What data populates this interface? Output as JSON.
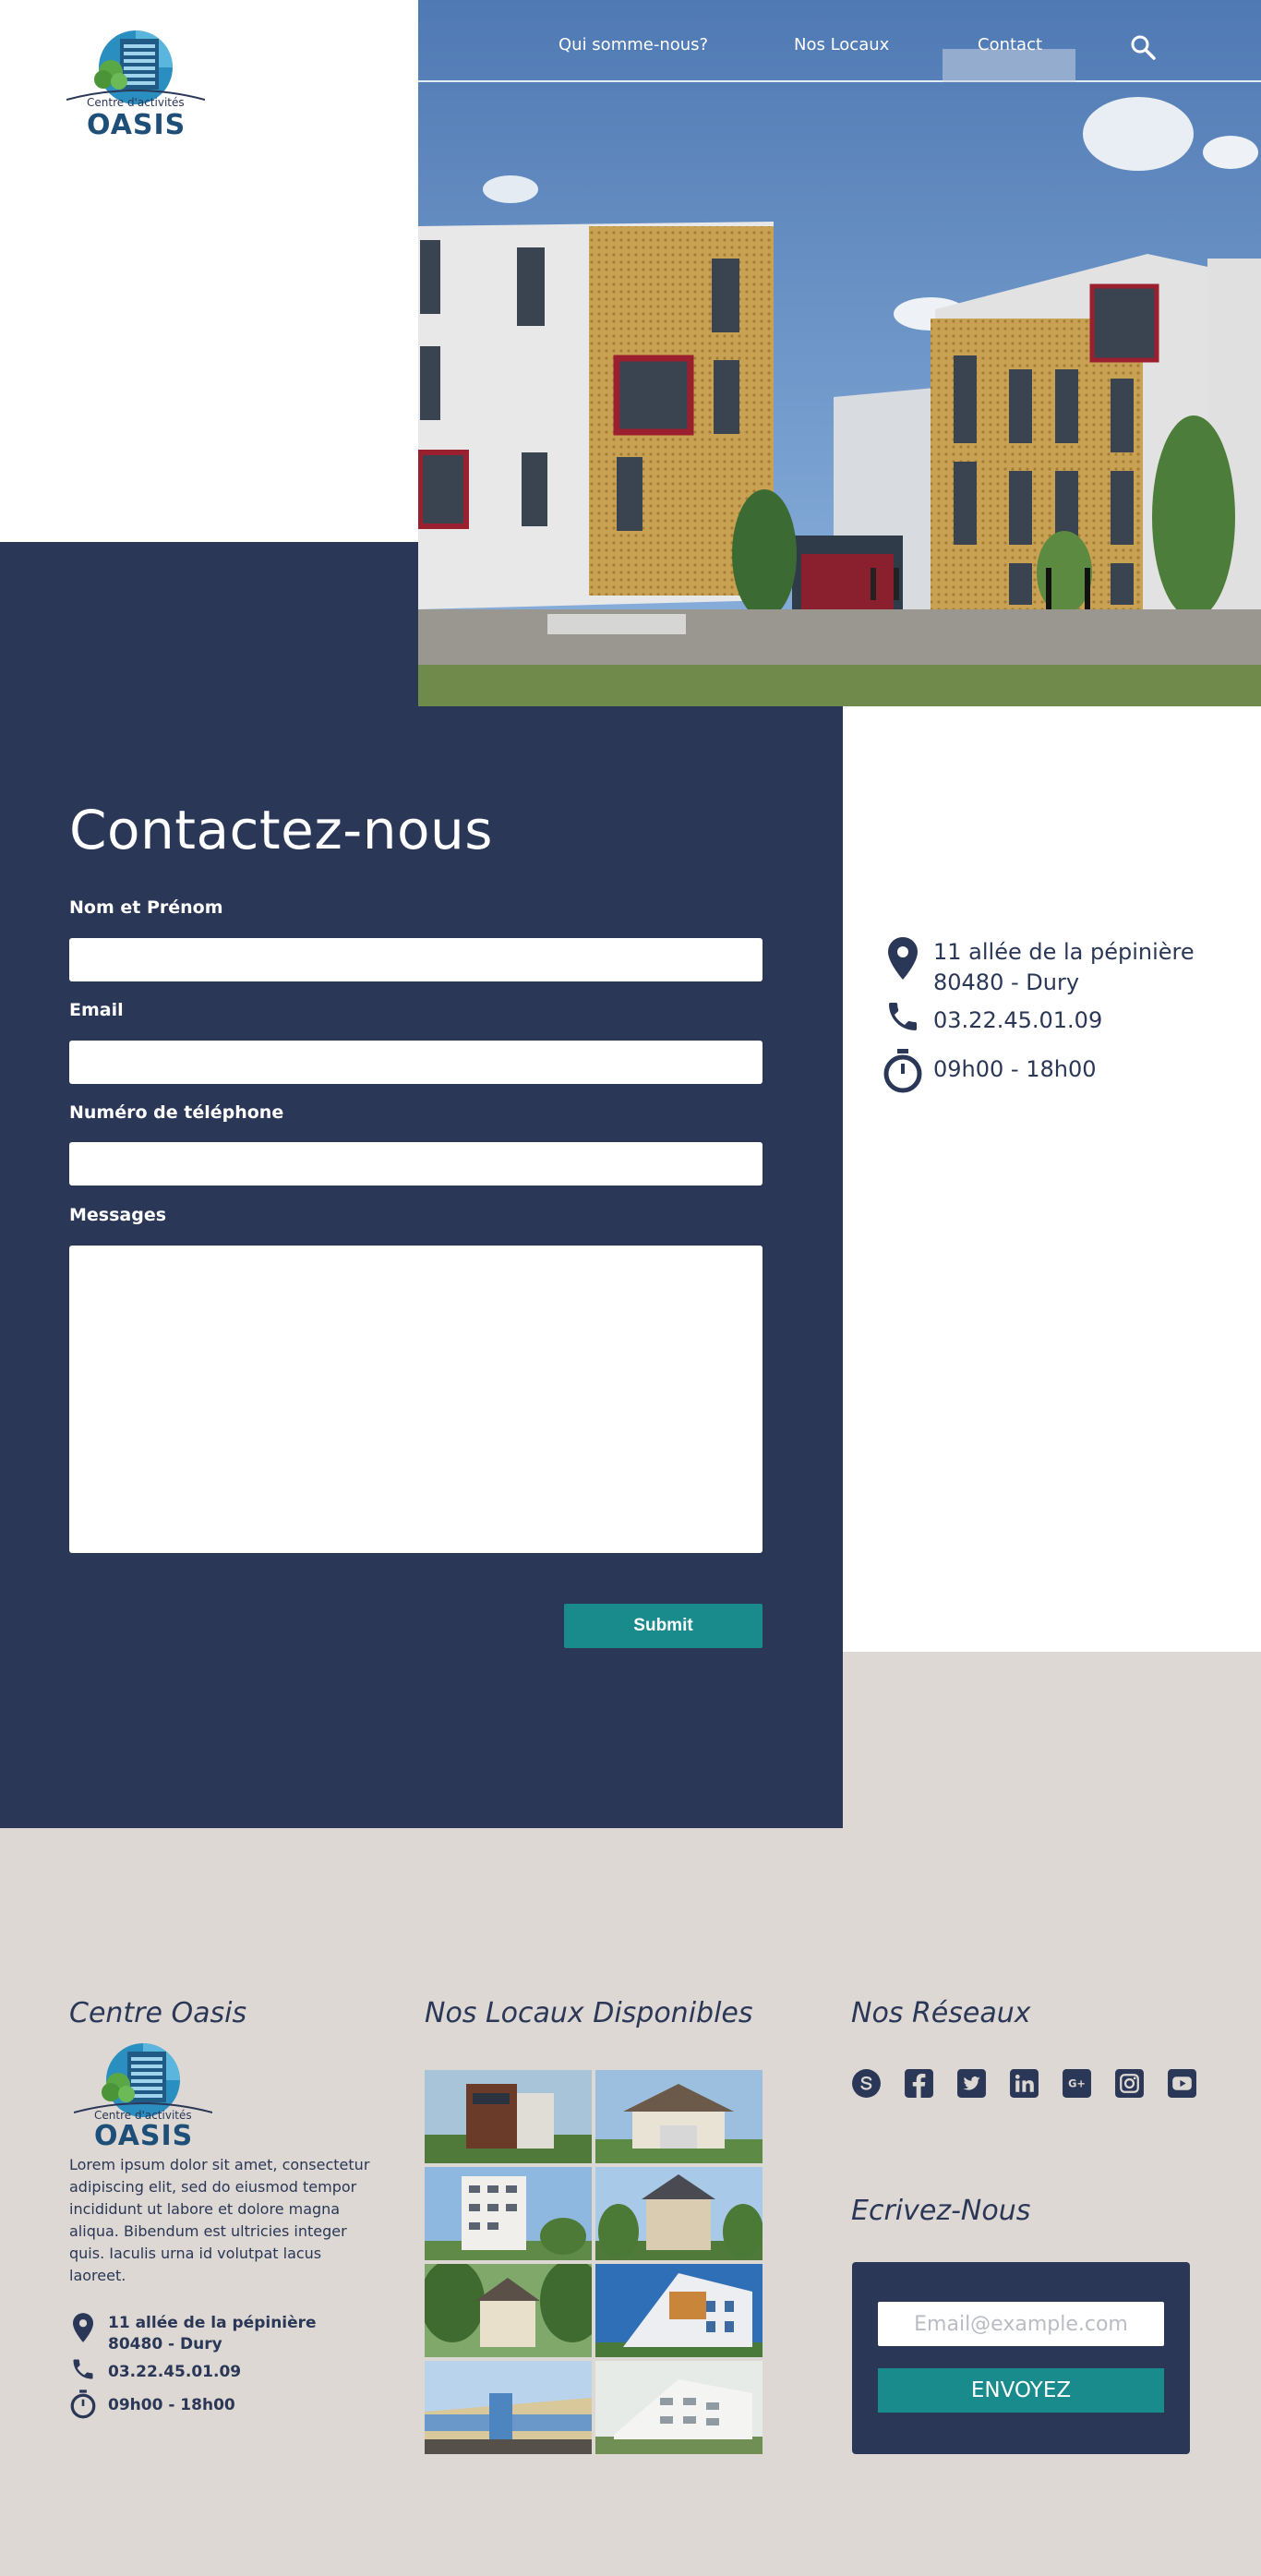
{
  "brand": {
    "logo_small_text": "Centre d'activités",
    "logo_name": "OASIS"
  },
  "nav": {
    "items": [
      "Qui somme-nous?",
      "Nos Locaux",
      "Contact"
    ],
    "active": "Contact",
    "search_icon": "search-icon"
  },
  "contact": {
    "title": "Contactez-nous",
    "fields": {
      "name_label": "Nom et Prénom",
      "email_label": "Email",
      "phone_label": "Numéro de téléphone",
      "message_label": "Messages"
    },
    "submit_label": "Submit"
  },
  "info": {
    "address_line1": "11 allée de la pépinière",
    "address_line2": "80480 - Dury",
    "phone": "03.22.45.01.09",
    "hours": "09h00 - 18h00"
  },
  "footer": {
    "col1_title": "Centre Oasis",
    "description": "Lorem ipsum dolor sit amet, consectetur adipiscing elit, sed do eiusmod tempor incididunt ut labore et dolore magna aliqua. Bibendum est ultricies integer quis. Iaculis urna id volutpat lacus laoreet.",
    "col2_title": "Nos Locaux Disponibles",
    "col3_title": "Nos Réseaux",
    "socials": [
      "skype-icon",
      "facebook-icon",
      "twitter-icon",
      "linkedin-icon",
      "google-plus-icon",
      "instagram-icon",
      "youtube-icon"
    ],
    "newsletter_title": "Ecrivez-Nous",
    "newsletter_placeholder": "Email@example.com",
    "newsletter_button": "ENVOYEZ"
  },
  "colors": {
    "navy": "#2a3756",
    "teal": "#1a8b8d",
    "beige": "#ddd8d3"
  }
}
